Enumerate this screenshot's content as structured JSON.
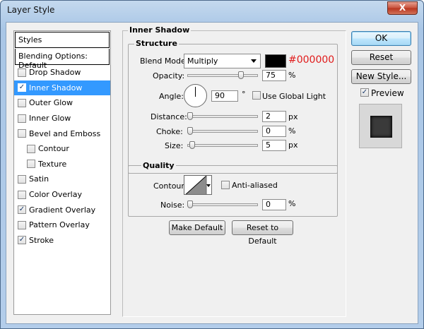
{
  "window": {
    "title": "Layer Style",
    "close_glyph": "X"
  },
  "styles_list": {
    "header": "Styles",
    "blending": "Blending Options: Default",
    "items": [
      {
        "label": "Drop Shadow",
        "checked": false,
        "sub": false
      },
      {
        "label": "Inner Shadow",
        "checked": true,
        "sub": false,
        "selected": true
      },
      {
        "label": "Outer Glow",
        "checked": false,
        "sub": false
      },
      {
        "label": "Inner Glow",
        "checked": false,
        "sub": false
      },
      {
        "label": "Bevel and Emboss",
        "checked": false,
        "sub": false
      },
      {
        "label": "Contour",
        "checked": false,
        "sub": true
      },
      {
        "label": "Texture",
        "checked": false,
        "sub": true
      },
      {
        "label": "Satin",
        "checked": false,
        "sub": false
      },
      {
        "label": "Color Overlay",
        "checked": false,
        "sub": false
      },
      {
        "label": "Gradient Overlay",
        "checked": true,
        "sub": false
      },
      {
        "label": "Pattern Overlay",
        "checked": false,
        "sub": false
      },
      {
        "label": "Stroke",
        "checked": true,
        "sub": false
      }
    ]
  },
  "panel": {
    "title": "Inner Shadow",
    "structure": {
      "legend": "Structure",
      "blend_mode_label": "Blend Mode:",
      "blend_mode_value": "Multiply",
      "color_hex": "#000000",
      "opacity_label": "Opacity:",
      "opacity_value": "75",
      "opacity_unit": "%",
      "opacity_level": 0.75,
      "angle_label": "Angle:",
      "angle_value": "90",
      "angle_unit": "°",
      "use_global_light": "Use Global Light",
      "distance_label": "Distance:",
      "distance_value": "2",
      "distance_unit": "px",
      "choke_label": "Choke:",
      "choke_value": "0",
      "choke_unit": "%",
      "size_label": "Size:",
      "size_value": "5",
      "size_unit": "px"
    },
    "quality": {
      "legend": "Quality",
      "contour_label": "Contour:",
      "anti_aliased": "Anti-aliased",
      "noise_label": "Noise:",
      "noise_value": "0",
      "noise_unit": "%"
    },
    "make_default": "Make Default",
    "reset_default": "Reset to Default"
  },
  "actions": {
    "ok": "OK",
    "reset": "Reset",
    "new_style": "New Style...",
    "preview": "Preview",
    "preview_checked": true
  },
  "colors": {
    "selection": "#3399ff",
    "hex_text": "#e11b1b",
    "shadow_color": "#000000"
  }
}
